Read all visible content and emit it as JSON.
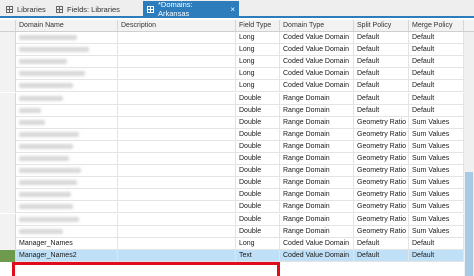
{
  "tabs": [
    {
      "label": "Libraries",
      "active": false
    },
    {
      "label": "Fields: Libraries",
      "active": false
    },
    {
      "label": "*Domains: Arkansas",
      "active": true
    }
  ],
  "close_glyph": "×",
  "columns": [
    "Domain Name",
    "Description",
    "Field Type",
    "Domain Type",
    "Split Policy",
    "Merge Policy"
  ],
  "rows": [
    {
      "name": "",
      "field_type": "Long",
      "domain_type": "Coded Value Domain",
      "split": "Default",
      "merge": "Default"
    },
    {
      "name": "",
      "field_type": "Long",
      "domain_type": "Coded Value Domain",
      "split": "Default",
      "merge": "Default"
    },
    {
      "name": "",
      "field_type": "Long",
      "domain_type": "Coded Value Domain",
      "split": "Default",
      "merge": "Default"
    },
    {
      "name": "",
      "field_type": "Long",
      "domain_type": "Coded Value Domain",
      "split": "Default",
      "merge": "Default"
    },
    {
      "name": "",
      "field_type": "Long",
      "domain_type": "Coded Value Domain",
      "split": "Default",
      "merge": "Default"
    },
    {
      "name": "",
      "field_type": "Double",
      "domain_type": "Range Domain",
      "split": "Default",
      "merge": "Default"
    },
    {
      "name": "",
      "field_type": "Double",
      "domain_type": "Range Domain",
      "split": "Default",
      "merge": "Default"
    },
    {
      "name": "",
      "field_type": "Double",
      "domain_type": "Range Domain",
      "split": "Geometry Ratio",
      "merge": "Sum Values"
    },
    {
      "name": "",
      "field_type": "Double",
      "domain_type": "Range Domain",
      "split": "Geometry Ratio",
      "merge": "Sum Values"
    },
    {
      "name": "",
      "field_type": "Double",
      "domain_type": "Range Domain",
      "split": "Geometry Ratio",
      "merge": "Sum Values"
    },
    {
      "name": "",
      "field_type": "Double",
      "domain_type": "Range Domain",
      "split": "Geometry Ratio",
      "merge": "Sum Values"
    },
    {
      "name": "",
      "field_type": "Double",
      "domain_type": "Range Domain",
      "split": "Geometry Ratio",
      "merge": "Sum Values"
    },
    {
      "name": "",
      "field_type": "Double",
      "domain_type": "Range Domain",
      "split": "Geometry Ratio",
      "merge": "Sum Values"
    },
    {
      "name": "",
      "field_type": "Double",
      "domain_type": "Range Domain",
      "split": "Geometry Ratio",
      "merge": "Sum Values"
    },
    {
      "name": "",
      "field_type": "Double",
      "domain_type": "Range Domain",
      "split": "Geometry Ratio",
      "merge": "Sum Values"
    },
    {
      "name": "",
      "field_type": "Double",
      "domain_type": "Range Domain",
      "split": "Geometry Ratio",
      "merge": "Sum Values"
    },
    {
      "name": "",
      "field_type": "Double",
      "domain_type": "Range Domain",
      "split": "Geometry Ratio",
      "merge": "Sum Values"
    },
    {
      "name": "Manager_Names",
      "field_type": "Long",
      "domain_type": "Coded Value Domain",
      "split": "Default",
      "merge": "Default"
    },
    {
      "name": "Manager_Names2",
      "field_type": "Text",
      "domain_type": "Coded Value Domain",
      "split": "Default",
      "merge": "Default",
      "selected": true
    }
  ],
  "colors": {
    "accent": "#2d7dbd",
    "selection": "#bfe0f6",
    "highlight_box": "#e10c1b",
    "row_indicator": "#6d9a4c"
  }
}
